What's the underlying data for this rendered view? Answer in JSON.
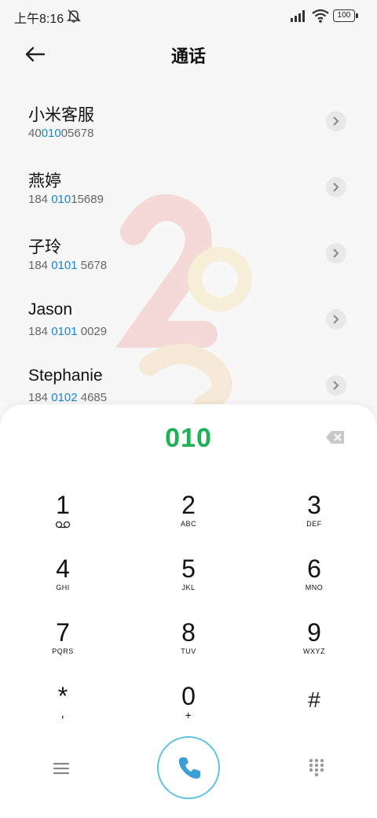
{
  "status_bar": {
    "time": "上午8:16",
    "battery": "100",
    "icons": [
      "mute-icon",
      "signal-icon",
      "wifi-icon",
      "battery-icon"
    ]
  },
  "header": {
    "title": "通话",
    "back_icon": "arrow-left-icon"
  },
  "contacts": [
    {
      "name": "小米客服",
      "number_pre": "40",
      "number_match": "010",
      "number_post": "05678"
    },
    {
      "name": "燕婷",
      "number_pre": "184 ",
      "number_match": "010",
      "number_post": "15689"
    },
    {
      "name": "子玲",
      "number_pre": "184 ",
      "number_match": "0101",
      "number_post": " 5678"
    },
    {
      "name": "Jason",
      "number_pre": "184 ",
      "number_match": "0101",
      "number_post": " 0029"
    },
    {
      "name": "Stephanie",
      "number_pre": "184 ",
      "number_match": "0102",
      "number_post": " 4685"
    }
  ],
  "dialpad": {
    "input": "010",
    "keys": [
      {
        "digit": "1",
        "letters": ""
      },
      {
        "digit": "2",
        "letters": "ABC"
      },
      {
        "digit": "3",
        "letters": "DEF"
      },
      {
        "digit": "4",
        "letters": "GHI"
      },
      {
        "digit": "5",
        "letters": "JKL"
      },
      {
        "digit": "6",
        "letters": "MNO"
      },
      {
        "digit": "7",
        "letters": "PQRS"
      },
      {
        "digit": "8",
        "letters": "TUV"
      },
      {
        "digit": "9",
        "letters": "WXYZ"
      },
      {
        "digit": "*",
        "letters": ","
      },
      {
        "digit": "0",
        "letters": "+"
      },
      {
        "digit": "#",
        "letters": ""
      }
    ]
  },
  "colors": {
    "match_highlight": "#1a84d6",
    "dialed_number": "#1fb254",
    "call_ring": "#5fc0e8",
    "call_icon": "#3a9fd8"
  },
  "bottom_bar": {
    "icons": [
      "menu-icon",
      "phone-icon",
      "keypad-icon"
    ]
  }
}
